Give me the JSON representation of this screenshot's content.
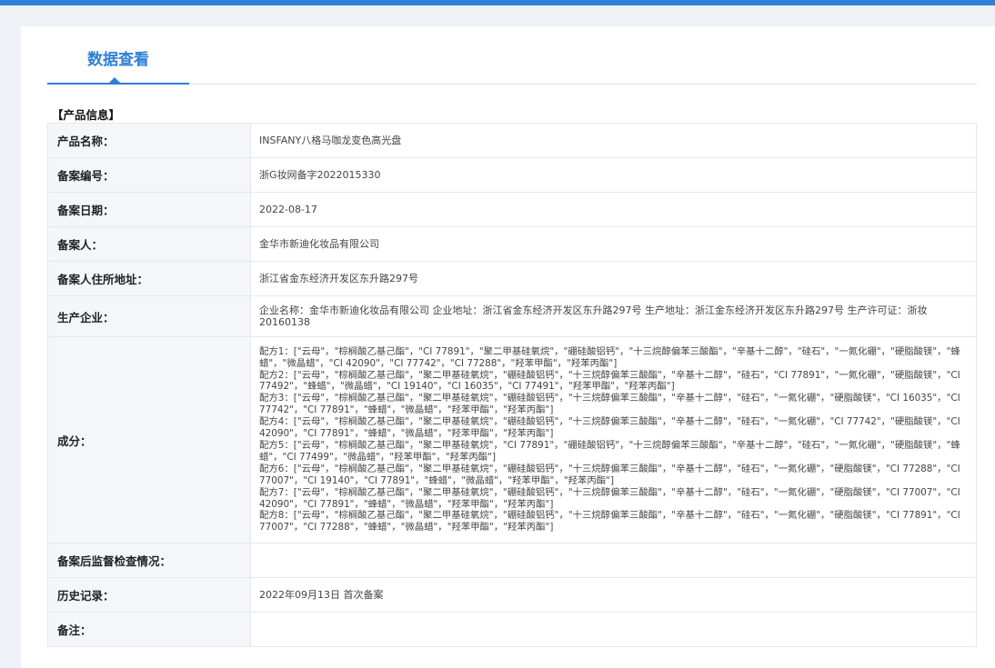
{
  "tab": {
    "label": "数据查看"
  },
  "section": {
    "title": "【产品信息】"
  },
  "rows": {
    "product_name": {
      "label": "产品名称：",
      "value": "INSFANY八格马咖龙变色高光盘"
    },
    "record_no": {
      "label": "备案编号：",
      "value": "浙G妆网备字2022015330"
    },
    "record_date": {
      "label": "备案日期：",
      "value": "2022-08-17"
    },
    "applicant": {
      "label": "备案人：",
      "value": "金华市新迪化妆品有限公司"
    },
    "applicant_address": {
      "label": "备案人住所地址：",
      "value": "浙江省金东经济开发区东升路297号"
    },
    "manufacturer": {
      "label": "生产企业：",
      "value": "企业名称：金华市新迪化妆品有限公司 企业地址：浙江省金东经济开发区东升路297号 生产地址：浙江金东经济开发区东升路297号 生产许可证：浙妆20160138"
    },
    "ingredients": {
      "label": "成分：",
      "formulas": [
        "配方1：[\"云母\"，\"棕榈酸乙基己酯\"，\"CI 77891\"，\"聚二甲基硅氧烷\"，\"硼硅酸铝钙\"，\"十三烷醇偏苯三酸酯\"，\"辛基十二醇\"，\"硅石\"，\"一氮化硼\"，\"硬脂酸镁\"，\"蜂蜡\"，\"微晶蜡\"，\"CI 42090\"，\"CI 77742\"，\"CI 77288\"，\"羟苯甲酯\"，\"羟苯丙酯\"]",
        "配方2：[\"云母\"，\"棕榈酸乙基己酯\"，\"聚二甲基硅氧烷\"，\"硼硅酸铝钙\"，\"十三烷醇偏苯三酸酯\"，\"辛基十二醇\"，\"硅石\"，\"CI 77891\"，\"一氮化硼\"，\"硬脂酸镁\"，\"CI 77492\"，\"蜂蜡\"，\"微晶蜡\"，\"CI 19140\"，\"CI 16035\"，\"CI 77491\"，\"羟苯甲酯\"，\"羟苯丙酯\"]",
        "配方3：[\"云母\"，\"棕榈酸乙基己酯\"，\"聚二甲基硅氧烷\"，\"硼硅酸铝钙\"，\"十三烷醇偏苯三酸酯\"，\"辛基十二醇\"，\"硅石\"，\"一氮化硼\"，\"硬脂酸镁\"，\"CI 16035\"，\"CI 77742\"，\"CI 77891\"，\"蜂蜡\"，\"微晶蜡\"，\"羟苯甲酯\"，\"羟苯丙酯\"]",
        "配方4：[\"云母\"，\"棕榈酸乙基己酯\"，\"聚二甲基硅氧烷\"，\"硼硅酸铝钙\"，\"十三烷醇偏苯三酸酯\"，\"辛基十二醇\"，\"硅石\"，\"一氮化硼\"，\"CI 77742\"，\"硬脂酸镁\"，\"CI 42090\"，\"CI 77891\"，\"蜂蜡\"，\"微晶蜡\"，\"羟苯甲酯\"，\"羟苯丙酯\"]",
        "配方5：[\"云母\"，\"棕榈酸乙基己酯\"，\"聚二甲基硅氧烷\"，\"CI 77891\"，\"硼硅酸铝钙\"，\"十三烷醇偏苯三酸酯\"，\"辛基十二醇\"，\"硅石\"，\"一氮化硼\"，\"硬脂酸镁\"，\"蜂蜡\"，\"CI 77499\"，\"微晶蜡\"，\"羟苯甲酯\"，\"羟苯丙酯\"]",
        "配方6：[\"云母\"，\"棕榈酸乙基己酯\"，\"聚二甲基硅氧烷\"，\"硼硅酸铝钙\"，\"十三烷醇偏苯三酸酯\"，\"辛基十二醇\"，\"硅石\"，\"一氮化硼\"，\"硬脂酸镁\"，\"CI 77288\"，\"CI 77007\"，\"CI 19140\"，\"CI 77891\"，\"蜂蜡\"，\"微晶蜡\"，\"羟苯甲酯\"，\"羟苯丙酯\"]",
        "配方7：[\"云母\"，\"棕榈酸乙基己酯\"，\"聚二甲基硅氧烷\"，\"硼硅酸铝钙\"，\"十三烷醇偏苯三酸酯\"，\"辛基十二醇\"，\"硅石\"，\"一氮化硼\"，\"硬脂酸镁\"，\"CI 77007\"，\"CI 42090\"，\"CI 77891\"，\"蜂蜡\"，\"微晶蜡\"，\"羟苯甲酯\"，\"羟苯丙酯\"]",
        "配方8：[\"云母\"，\"棕榈酸乙基己酯\"，\"聚二甲基硅氧烷\"，\"硼硅酸铝钙\"，\"十三烷醇偏苯三酸酯\"，\"辛基十二醇\"，\"硅石\"，\"一氮化硼\"，\"硬脂酸镁\"，\"CI 77891\"，\"CI 77007\"，\"CI 77288\"，\"蜂蜡\"，\"微晶蜡\"，\"羟苯甲酯\"，\"羟苯丙酯\"]"
      ]
    },
    "post_inspection": {
      "label": "备案后监督检查情况：",
      "value": ""
    },
    "history": {
      "label": "历史记录：",
      "value": "2022年09月13日 首次备案"
    },
    "remarks": {
      "label": "备注：",
      "value": ""
    }
  },
  "colors": {
    "accent": "#2f7fd6",
    "table_border": "#a9c6e3",
    "label_bg": "#f4f6f9"
  }
}
